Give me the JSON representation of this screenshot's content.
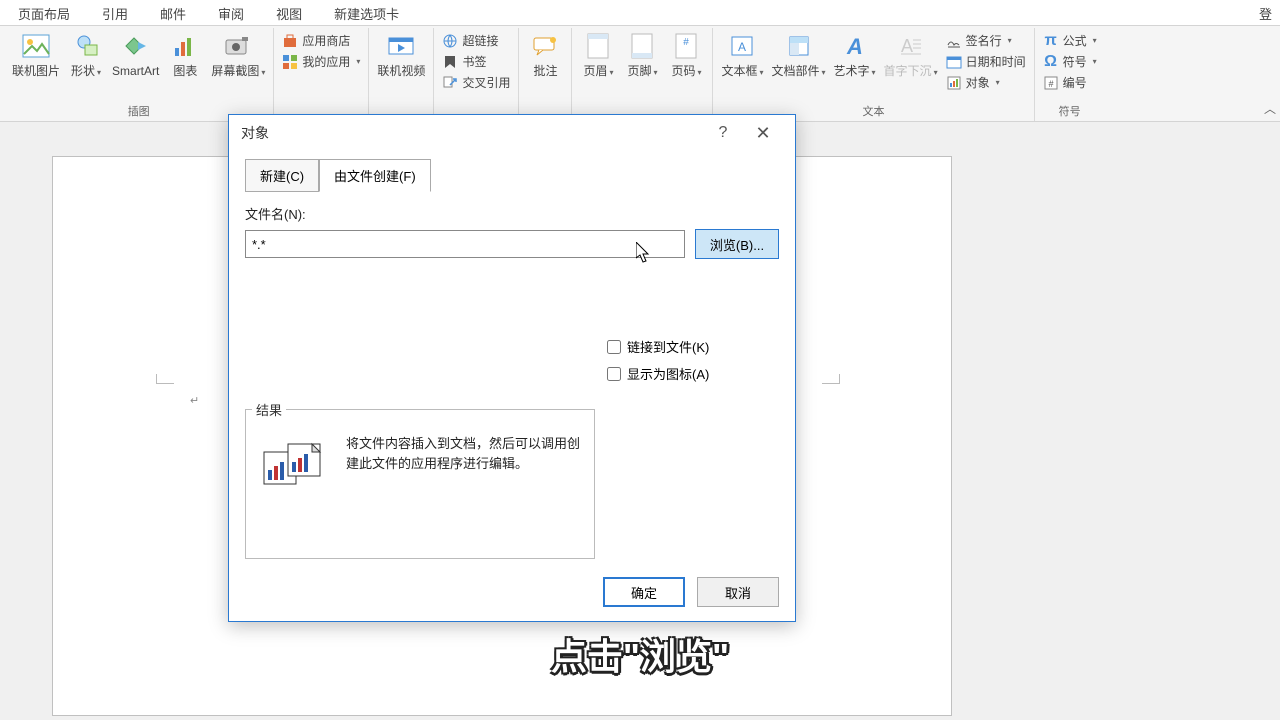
{
  "ribbon_tabs": [
    "页面布局",
    "引用",
    "邮件",
    "审阅",
    "视图",
    "新建选项卡"
  ],
  "login": "登",
  "ribbon": {
    "g_illustration": {
      "label": "插图",
      "items": [
        "联机图片",
        "形状",
        "SmartArt",
        "图表",
        "屏幕截图"
      ]
    },
    "g_app": {
      "store": "应用商店",
      "my": "我的应用"
    },
    "g_media": {
      "label": "联机视频"
    },
    "g_links": {
      "h": "超链接",
      "b": "书签",
      "c": "交叉引用"
    },
    "g_comment": {
      "label": "批注"
    },
    "g_hf": {
      "header": "页眉",
      "footer": "页脚",
      "pagenum": "页码"
    },
    "g_text": {
      "label": "文本",
      "textbox": "文本框",
      "parts": "文档部件",
      "wordart": "艺术字",
      "dropcap": "首字下沉",
      "sig": "签名行",
      "dt": "日期和时间",
      "obj": "对象"
    },
    "g_symbol": {
      "label": "符号",
      "eq": "公式",
      "sym": "符号",
      "num": "编号"
    }
  },
  "dialog": {
    "title": "对象",
    "tab_new": "新建(C)",
    "tab_file": "由文件创建(F)",
    "lbl_filename": "文件名(N):",
    "filename": "*.*",
    "browse": "浏览(B)...",
    "chk_link": "链接到文件(K)",
    "chk_icon": "显示为图标(A)",
    "result_legend": "结果",
    "result_text": "将文件内容插入到文档，然后可以调用创建此文件的应用程序进行编辑。",
    "ok": "确定",
    "cancel": "取消"
  },
  "caption": "点击\"浏览\""
}
